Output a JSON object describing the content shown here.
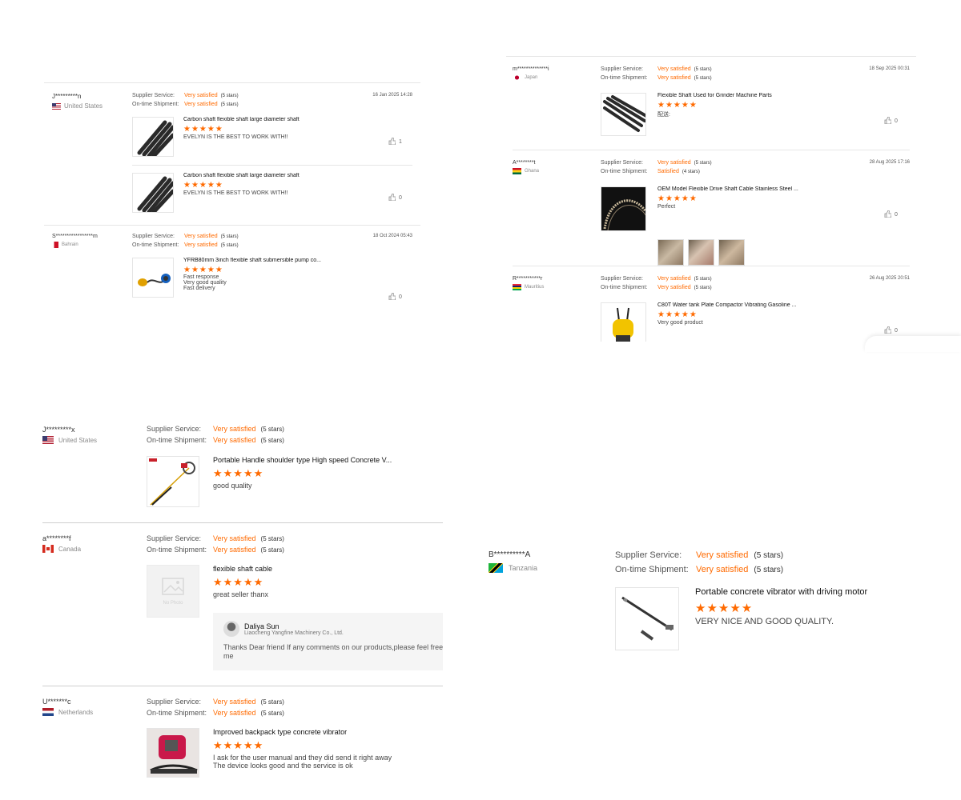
{
  "labels": {
    "supplier_service": "Supplier Service:",
    "on_time_shipment": "On-time Shipment:",
    "stars_icon": "★★★★★",
    "no_photo": "No Photo"
  },
  "panel_tl": {
    "r1": {
      "user": "J*********n",
      "country": "United States",
      "date": "16 Jan 2025 14:28",
      "service": "Very satisfied",
      "service_stars": "(5 stars)",
      "shipment": "Very satisfied",
      "shipment_stars": "(5 stars)",
      "p1": {
        "title": "Carbon shaft flexible shaft large diameter shaft",
        "comment": "EVELYN IS THE BEST TO WORK WITH!!",
        "likes": "1"
      },
      "p2": {
        "title": "Carbon shaft flexible shaft large diameter shaft",
        "comment": "EVELYN IS THE BEST TO WORK WITH!!",
        "likes": "0"
      }
    },
    "r2": {
      "user": "S*****************m",
      "country": "Bahrain",
      "date": "18 Oct 2024 05:43",
      "service": "Very satisfied",
      "service_stars": "(5 stars)",
      "shipment": "Very satisfied",
      "shipment_stars": "(5 stars)",
      "p1": {
        "title": "YFRB80mm 3inch flexible shaft submersible pump co...",
        "comment_lines": [
          "Fast response",
          "Very good quality",
          "Fast delivery"
        ],
        "likes": "0"
      }
    }
  },
  "panel_tr": {
    "r1": {
      "user": "m**************i",
      "country": "Japan",
      "date": "18 Sep 2025 00:31",
      "service": "Very satisfied",
      "service_stars": "(5 stars)",
      "shipment": "Very satisfied",
      "shipment_stars": "(5 stars)",
      "p1": {
        "title": "Flexible Shaft Used for Grinder Machine Parts",
        "comment": "配送:",
        "likes": "0"
      }
    },
    "r2": {
      "user": "A********t",
      "country": "Ghana",
      "date": "28 Aug 2025 17:16",
      "service": "Very satisfied",
      "service_stars": "(5 stars)",
      "shipment": "Satisfied",
      "shipment_stars": "(4 stars)",
      "p1": {
        "title": "OEM Model Flexible Drive Shaft Cable Stainless Steel ...",
        "comment": "Perfect",
        "likes": "0"
      }
    },
    "r3": {
      "user": "R***********r",
      "country": "Mauritius",
      "date": "26 Aug 2025 20:51",
      "service": "Very satisfied",
      "service_stars": "(5 stars)",
      "shipment": "Very satisfied",
      "shipment_stars": "(5 stars)",
      "p1": {
        "title": "C80T Water tank Plate Compactor Vibrating Gasoline ...",
        "comment": "Very good product",
        "likes": "0"
      }
    }
  },
  "panel_bl": {
    "r1": {
      "user": "J*********x",
      "country": "United States",
      "service": "Very satisfied",
      "service_stars": "(5 stars)",
      "shipment": "Very satisfied",
      "shipment_stars": "(5 stars)",
      "p1": {
        "title": "Portable Handle shoulder type High speed Concrete V...",
        "comment": "good quality"
      }
    },
    "r2": {
      "user": "a********f",
      "country": "Canada",
      "service": "Very satisfied",
      "service_stars": "(5 stars)",
      "shipment": "Very satisfied",
      "shipment_stars": "(5 stars)",
      "p1": {
        "title": "flexible shaft cable",
        "comment": "great seller thanx"
      },
      "reply": {
        "name": "Daliya Sun",
        "company": "Liaocheng Yangfine Machinery Co., Ltd.",
        "text": "Thanks Dear friend If any comments on our products,please feel free me"
      }
    },
    "r3": {
      "user": "U*******c",
      "country": "Netherlands",
      "service": "Very satisfied",
      "service_stars": "(5 stars)",
      "shipment": "Very satisfied",
      "shipment_stars": "(5 stars)",
      "p1": {
        "title": "Improved backpack type concrete vibrator",
        "comment_lines": [
          "I ask for the user manual and they did send it right away",
          "The device looks good and the service is ok"
        ]
      }
    }
  },
  "panel_br": {
    "r1": {
      "user": "B**********A",
      "country": "Tanzania",
      "service": "Very satisfied",
      "service_stars": "(5 stars)",
      "shipment": "Very satisfied",
      "shipment_stars": "(5 stars)",
      "p1": {
        "title": "Portable concrete vibrator with driving motor",
        "comment": "VERY NICE AND GOOD QUALITY."
      }
    }
  }
}
